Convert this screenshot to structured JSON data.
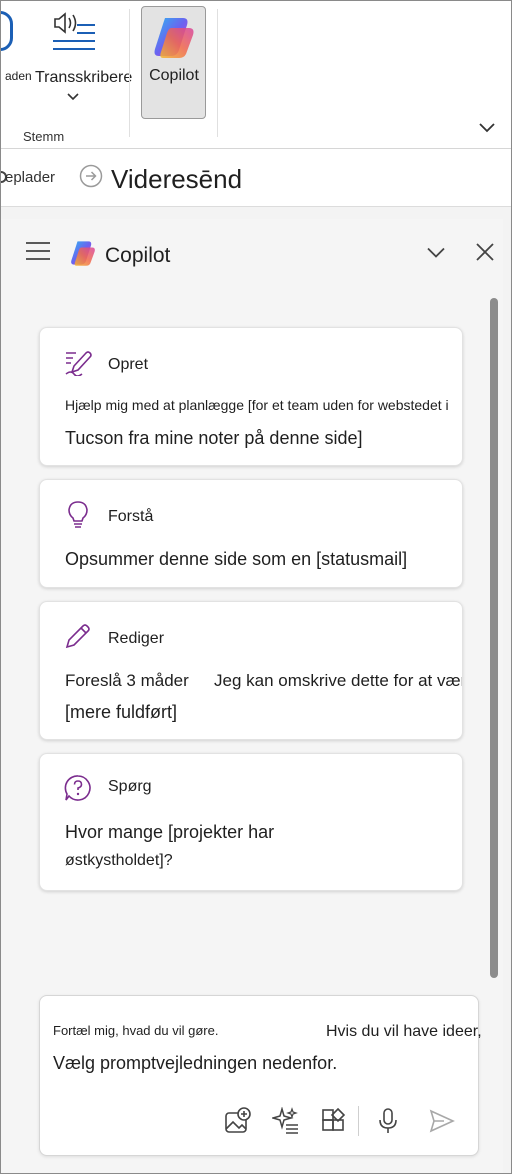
{
  "ribbon": {
    "cut_label": "aden",
    "transcribe_label": "Transskribere",
    "group_label": "Stemm",
    "copilot_label": "Copilot"
  },
  "actionbar": {
    "cut_label": "eplader",
    "forward_label": "Videresēnd"
  },
  "pane": {
    "title": "Copilot"
  },
  "cards": [
    {
      "title": "Opret",
      "line1": "Hjælp mig med at planlægge [for et team uden for webstedet i",
      "line2": "Tucson fra mine noter på denne side]"
    },
    {
      "title": "Forstå",
      "line1": "Opsummer denne side som en [statusmail]"
    },
    {
      "title": "Rediger",
      "line1": "Foreslå 3 måder",
      "line1b": "Jeg kan omskrive dette for at være",
      "line2": "[mere fuldført]"
    },
    {
      "title": "Spørg",
      "line1": "Hvor mange [projekter har",
      "line2": "østkystholdet]?"
    }
  ],
  "input": {
    "prompt_part1": "Fortæl mig, hvad du vil gøre.",
    "prompt_part2": "Hvis du vil have ideer,",
    "prompt_part3": "Vælg promptvejledningen nedenfor."
  },
  "colors": {
    "accent_purple": "#7b2d8e",
    "mic_blue": "#1b5fb5"
  },
  "icons": {
    "create": "pen-doc-icon",
    "understand": "lightbulb-icon",
    "edit": "pencil-icon",
    "ask": "question-bubble-icon"
  }
}
